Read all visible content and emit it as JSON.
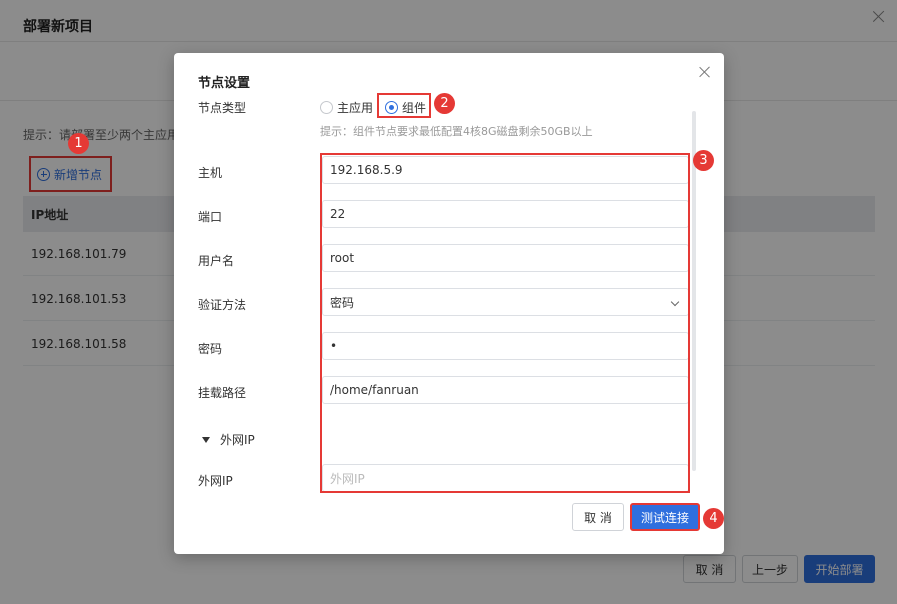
{
  "background": {
    "title": "部署新项目",
    "hint": "提示：请部署至少两个主应用",
    "add_node_label": "新增节点",
    "table_header": "IP地址",
    "rows": [
      "192.168.101.79",
      "192.168.101.53",
      "192.168.101.58"
    ],
    "footer": {
      "cancel": "取 消",
      "prev": "上一步",
      "start": "开始部署"
    }
  },
  "dialog": {
    "title": "节点设置",
    "node_type_label": "节点类型",
    "radio_options": [
      "主应用",
      "组件"
    ],
    "selected_option": "组件",
    "tip": "提示：组件节点要求最低配置4核8G磁盘剩余50GB以上",
    "fields": {
      "host": {
        "label": "主机",
        "value": "192.168.5.9"
      },
      "port": {
        "label": "端口",
        "value": "22"
      },
      "username": {
        "label": "用户名",
        "value": "root"
      },
      "auth": {
        "label": "验证方法",
        "value": "密码"
      },
      "password": {
        "label": "密码",
        "value": "•"
      },
      "mount": {
        "label": "挂载路径",
        "value": "/home/fanruan"
      },
      "public_ip": {
        "label": "外网IP",
        "placeholder": "外网IP"
      }
    },
    "section_label": "外网IP",
    "cancel_label": "取 消",
    "test_label": "测试连接"
  },
  "annotations": [
    "1",
    "2",
    "3",
    "4"
  ],
  "colors": {
    "accent": "#2f6fde",
    "annotation": "#e53935"
  }
}
